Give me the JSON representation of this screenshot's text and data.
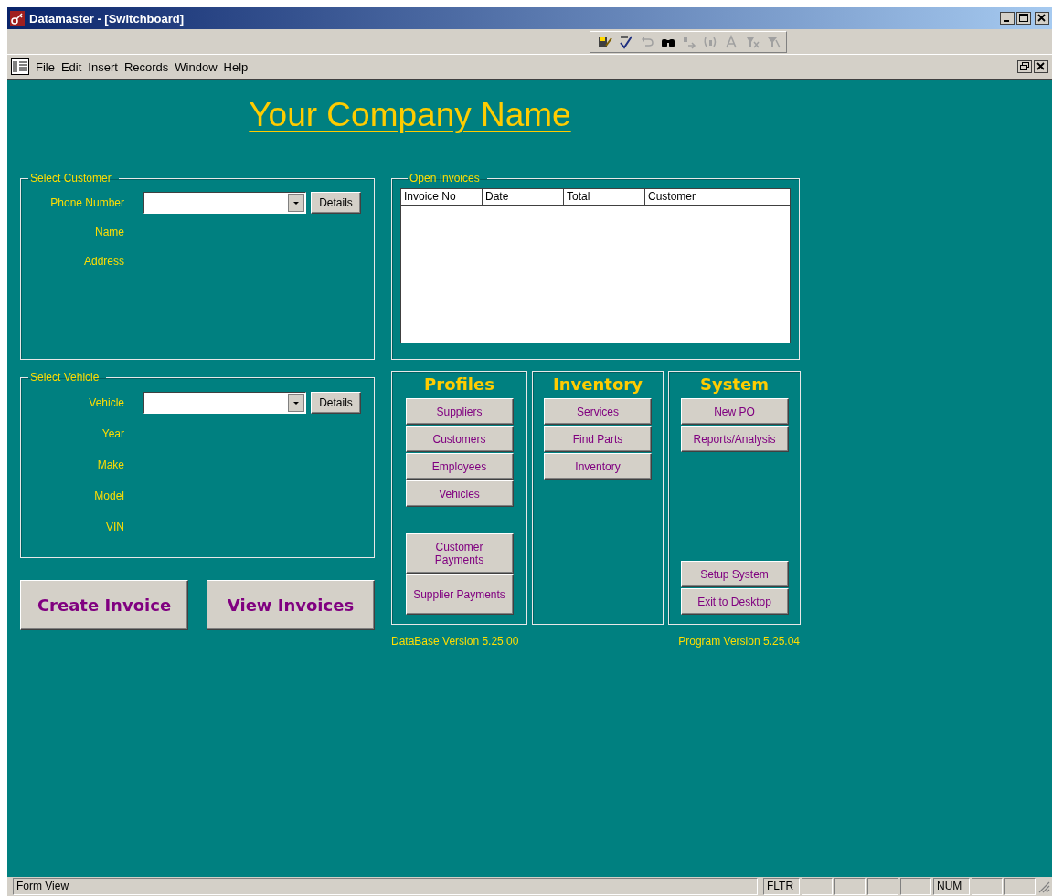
{
  "window": {
    "title": "Datamaster - [Switchboard]"
  },
  "menu": [
    "File",
    "Edit",
    "Insert",
    "Records",
    "Window",
    "Help"
  ],
  "form": {
    "company_name": "Your Company Name",
    "customer": {
      "legend": "Select Customer",
      "fields": [
        {
          "label": "Phone Number",
          "kind": "combo",
          "button": "Details"
        },
        {
          "label": "Name",
          "kind": "text"
        },
        {
          "label": "Address",
          "kind": "text"
        }
      ]
    },
    "vehicle": {
      "legend": "Select Vehicle",
      "fields": [
        {
          "label": "Vehicle",
          "kind": "combo",
          "button": "Details"
        },
        {
          "label": "Year",
          "kind": "text"
        },
        {
          "label": "Make",
          "kind": "text"
        },
        {
          "label": "Model",
          "kind": "text"
        },
        {
          "label": "VIN",
          "kind": "text"
        }
      ]
    },
    "actions": [
      "Create Invoice",
      "View Invoices"
    ],
    "invoices": {
      "legend": "Open Invoices",
      "columns": [
        "Invoice No",
        "Date",
        "Total",
        "Customer"
      ]
    },
    "panels": [
      {
        "title": "Profiles",
        "groups": [
          [
            {
              "label": "Suppliers",
              "kind": "normal"
            },
            {
              "label": "Customers",
              "kind": "normal"
            },
            {
              "label": "Employees",
              "kind": "normal"
            },
            {
              "label": "Vehicles",
              "kind": "normal"
            }
          ],
          [
            {
              "label": "Customer Payments",
              "kind": "tall"
            },
            {
              "label": "Supplier Payments",
              "kind": "tall"
            }
          ]
        ]
      },
      {
        "title": "Inventory",
        "groups": [
          [
            {
              "label": "Services",
              "kind": "normal"
            },
            {
              "label": "Find Parts",
              "kind": "normal"
            },
            {
              "label": "Inventory",
              "kind": "normal"
            }
          ]
        ]
      },
      {
        "title": "System",
        "groups": [
          [
            {
              "label": "New PO",
              "kind": "normal"
            },
            {
              "label": "Reports/Analysis",
              "kind": "normal"
            }
          ],
          [
            {
              "label": "Setup System",
              "kind": "normal"
            },
            {
              "label": "Exit to Desktop",
              "kind": "normal"
            }
          ]
        ]
      }
    ],
    "database_version": "DataBase Version 5.25.00",
    "program_version": "Program Version 5.25.04"
  },
  "status_bar": {
    "text": "Form View",
    "indicators": [
      "FLTR",
      "NUM"
    ]
  }
}
